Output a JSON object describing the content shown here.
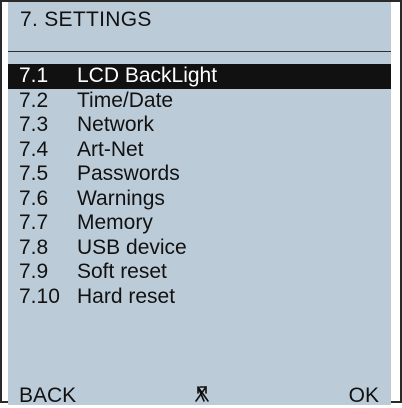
{
  "screen": {
    "title": "7. SETTINGS",
    "selected_index": 0
  },
  "menu": {
    "items": [
      {
        "number": "7.1",
        "label": "LCD BackLight"
      },
      {
        "number": "7.2",
        "label": "Time/Date"
      },
      {
        "number": "7.3",
        "label": "Network"
      },
      {
        "number": "7.4",
        "label": "Art-Net"
      },
      {
        "number": "7.5",
        "label": "Passwords"
      },
      {
        "number": "7.6",
        "label": "Warnings"
      },
      {
        "number": "7.7",
        "label": "Memory"
      },
      {
        "number": "7.8",
        "label": "USB device"
      },
      {
        "number": "7.9",
        "label": "Soft reset"
      },
      {
        "number": "7.10",
        "label": "Hard reset"
      }
    ]
  },
  "softkeys": {
    "left": "BACK",
    "center_icon": "up-down-arrows-icon",
    "right": "OK"
  },
  "colors": {
    "screen_background": "#bccbd8",
    "text": "#111111",
    "highlight_background": "#111111",
    "highlight_text": "#ffffff"
  }
}
